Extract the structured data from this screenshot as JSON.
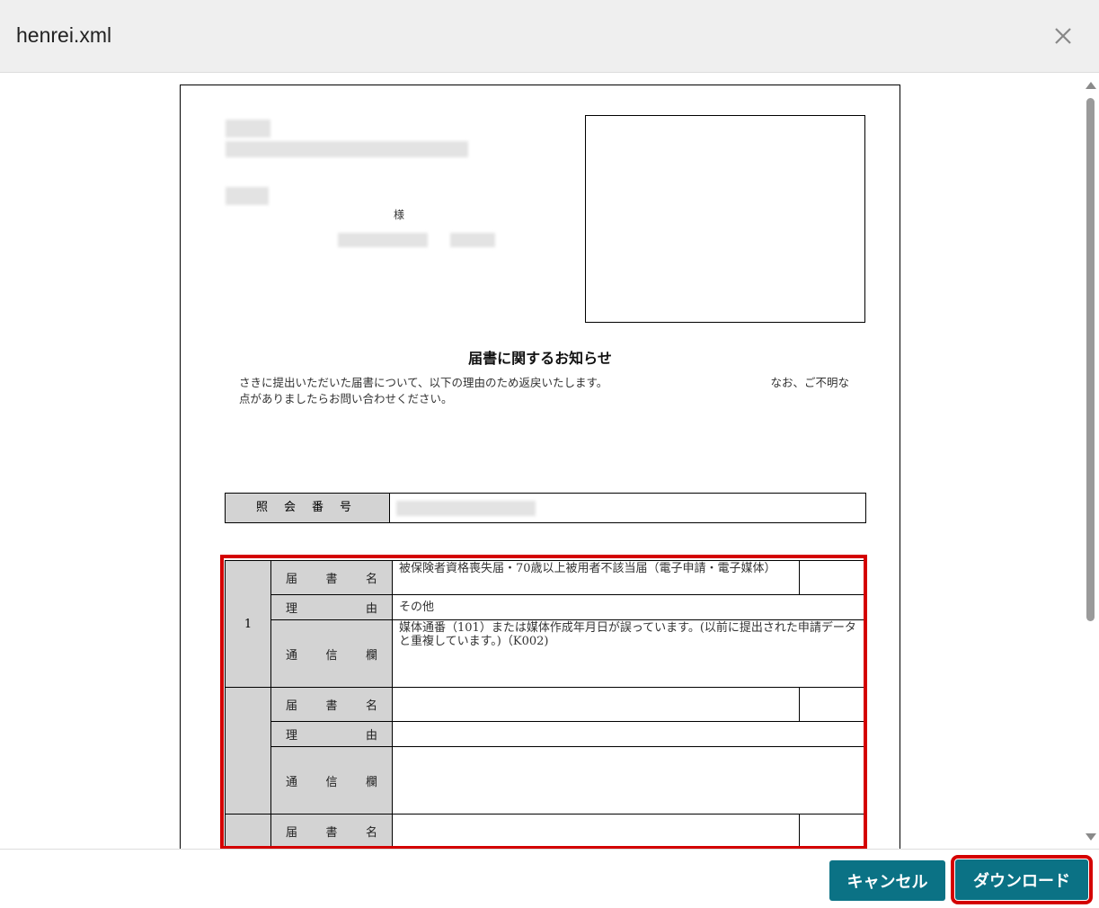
{
  "dialog": {
    "title": "henrei.xml",
    "close_icon": "close-icon"
  },
  "document": {
    "sama": "様",
    "notice_title": "届書に関するお知らせ",
    "notice_body": "さきに提出いただいた届書について、以下の理由のため返戻いたします。　　　　　　　　　　　　　　　なお、ご不明な点がありましたらお問い合わせください。",
    "reference_label": "照会番号",
    "labels": {
      "form_name": [
        "届",
        "書",
        "名"
      ],
      "reason": [
        "理",
        "由"
      ],
      "comments": [
        "通",
        "信",
        "欄"
      ]
    },
    "entries": [
      {
        "number": "1",
        "form_name": "被保険者資格喪失届・70歳以上被用者不該当届（電子申請・電子媒体）",
        "reason": "その他",
        "comments": "媒体通番（101）または媒体作成年月日が誤っています。(以前に提出された申請データと重複しています。)（K002)"
      },
      {
        "number": "",
        "form_name": "",
        "reason": "",
        "comments": ""
      },
      {
        "number": "",
        "form_name": ""
      }
    ]
  },
  "footer": {
    "cancel_label": "キャンセル",
    "download_label": "ダウンロード"
  },
  "colors": {
    "accent": "#0b7285",
    "highlight": "#d40000",
    "label_bg": "#d3d3d3"
  }
}
